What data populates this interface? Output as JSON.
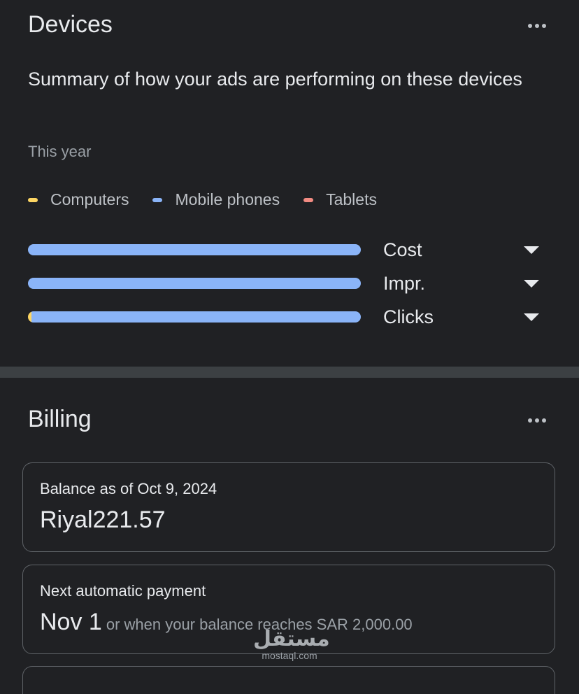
{
  "devices": {
    "title": "Devices",
    "menu_icon": "more-horizontal-icon",
    "subtitle": "Summary of how your ads are performing on these devices",
    "period": "This year",
    "legend": [
      {
        "label": "Computers",
        "color": "#fdd663"
      },
      {
        "label": "Mobile phones",
        "color": "#8ab4f8"
      },
      {
        "label": "Tablets",
        "color": "#f28b82"
      }
    ],
    "metrics": [
      {
        "label": "Cost",
        "share": {
          "computers": 0.0,
          "mobile": 1.0,
          "tablets": 0.0
        },
        "caret_icon": "caret-down-icon"
      },
      {
        "label": "Impr.",
        "share": {
          "computers": 0.0,
          "mobile": 1.0,
          "tablets": 0.0
        },
        "caret_icon": "caret-down-icon"
      },
      {
        "label": "Clicks",
        "share": {
          "computers": 0.01,
          "mobile": 0.99,
          "tablets": 0.0
        },
        "caret_icon": "caret-down-icon"
      }
    ]
  },
  "billing": {
    "title": "Billing",
    "menu_icon": "more-horizontal-icon",
    "balance_caption": "Balance as of Oct 9, 2024",
    "balance_value": "Riyal221.57",
    "next_payment_caption": "Next automatic payment",
    "next_payment_date": "Nov 1",
    "next_payment_note": "or when your balance reaches SAR 2,000.00"
  },
  "watermark": {
    "arabic": "مستقل",
    "latin": "mostaql.com"
  }
}
